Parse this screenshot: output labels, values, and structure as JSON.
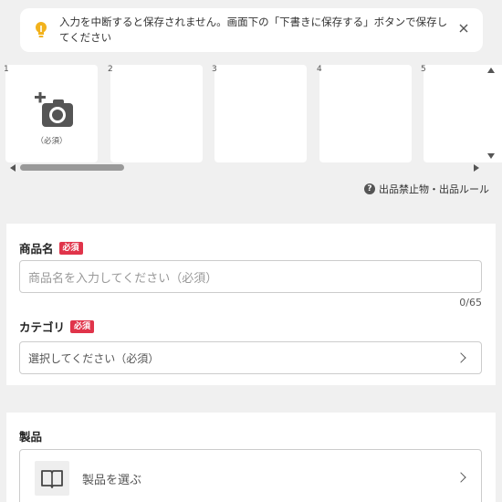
{
  "notice": {
    "text": "入力を中断すると保存されません。画面下の「下書きに保存する」ボタンで保存してください",
    "icon": "lightbulb-icon",
    "close_icon": "close-icon"
  },
  "photos": {
    "slots": [
      {
        "number": "1",
        "caption": "（必須）"
      },
      {
        "number": "2"
      },
      {
        "number": "3"
      },
      {
        "number": "4"
      },
      {
        "number": "5"
      }
    ]
  },
  "rules_link": {
    "label": "出品禁止物・出品ルール",
    "icon": "question-icon"
  },
  "form": {
    "title": {
      "label": "商品名",
      "badge": "必須",
      "placeholder": "商品名を入力してください（必須）",
      "counter": "0/65"
    },
    "category": {
      "label": "カテゴリ",
      "badge": "必須",
      "placeholder": "選択してください（必須）"
    }
  },
  "product": {
    "label": "製品",
    "select_label": "製品を選ぶ",
    "icon": "book-icon"
  },
  "colors": {
    "required_badge": "#e0344a",
    "bulb": "#f2b21c",
    "background": "#f0f0f0"
  }
}
